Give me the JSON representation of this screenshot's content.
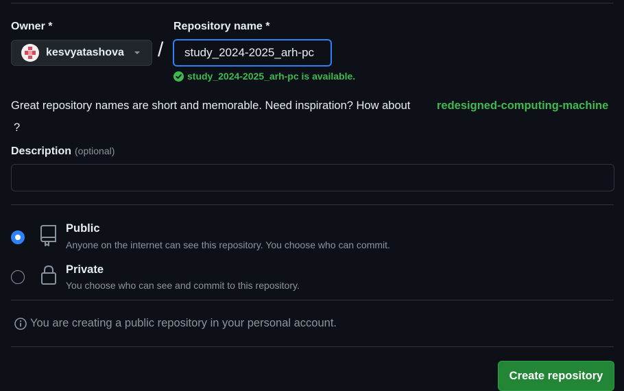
{
  "owner": {
    "label": "Owner *",
    "name": "kesvyatashova"
  },
  "repo": {
    "label": "Repository name *",
    "value": "study_2024-2025_arh-pc",
    "availability": "study_2024-2025_arh-pc is available."
  },
  "separator": "/",
  "inspiration": {
    "text": "Great repository names are short and memorable. Need inspiration? How about",
    "suggestion": "redesigned-computing-machine",
    "trailing": "?"
  },
  "description": {
    "label": "Description",
    "optional": "(optional)",
    "value": ""
  },
  "visibility": {
    "public": {
      "title": "Public",
      "desc": "Anyone on the internet can see this repository. You choose who can commit.",
      "selected": true
    },
    "private": {
      "title": "Private",
      "desc": "You choose who can see and commit to this repository.",
      "selected": false
    }
  },
  "notice": "You are creating a public repository in your personal account.",
  "create_button": "Create repository",
  "colors": {
    "background": "#0d1117",
    "accent": "#2f81f7",
    "success": "#3fb950",
    "button": "#238636"
  }
}
